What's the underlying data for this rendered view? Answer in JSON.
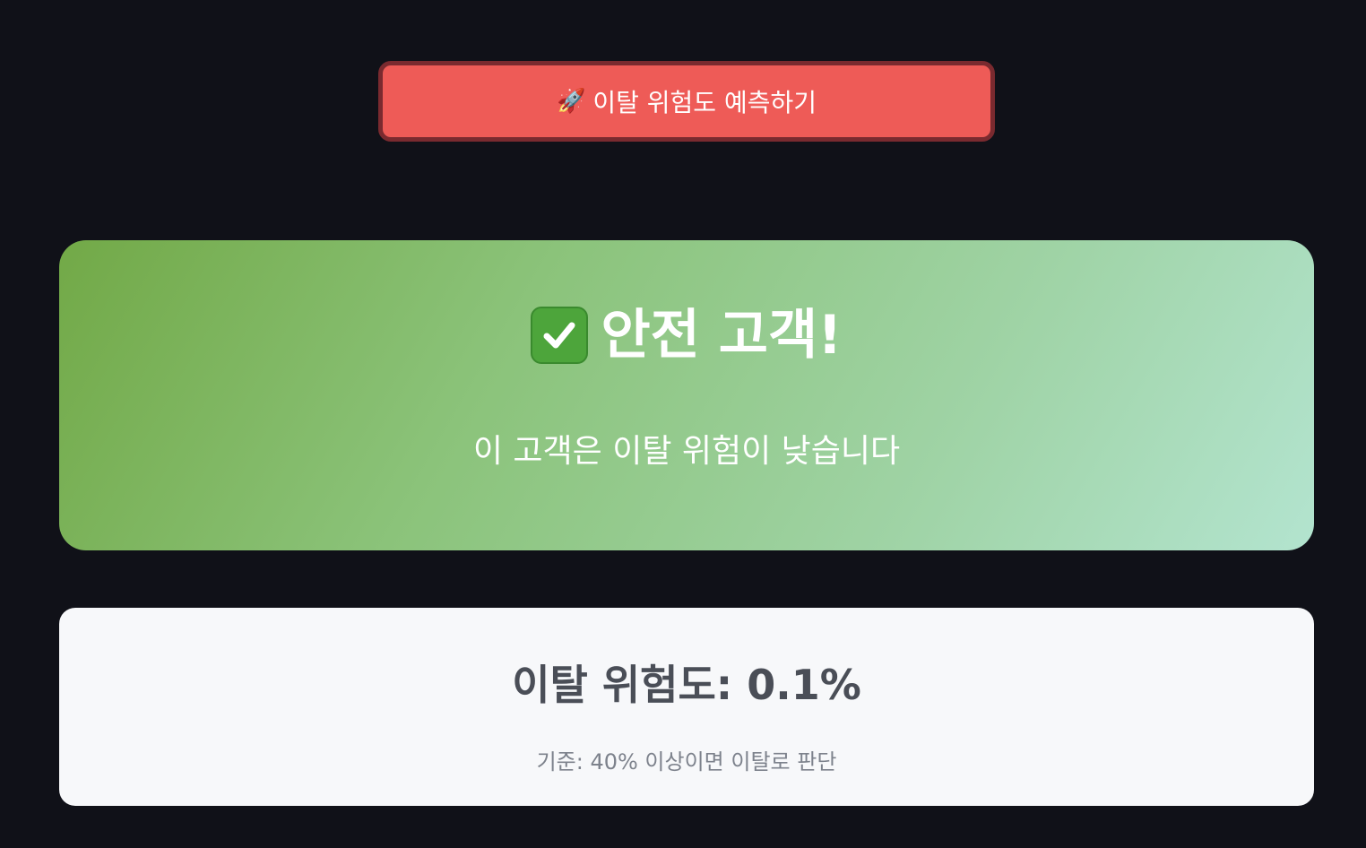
{
  "predict_button": {
    "icon": "rocket-icon",
    "label": "이탈 위험도 예측하기",
    "color": "#ee5b57"
  },
  "result": {
    "icon": "check-mark-icon",
    "title": "안전 고객!",
    "subtitle": "이 고객은 이탈 위험이 낮습니다",
    "gradient_start": "#72a947",
    "gradient_end": "#b3e4cf"
  },
  "risk": {
    "value_text": "이탈 위험도: 0.1%",
    "criteria_text": "기준: 40% 이상이면 이탈로 판단"
  },
  "colors": {
    "background": "#101118",
    "card_background": "#f7f8fa"
  }
}
